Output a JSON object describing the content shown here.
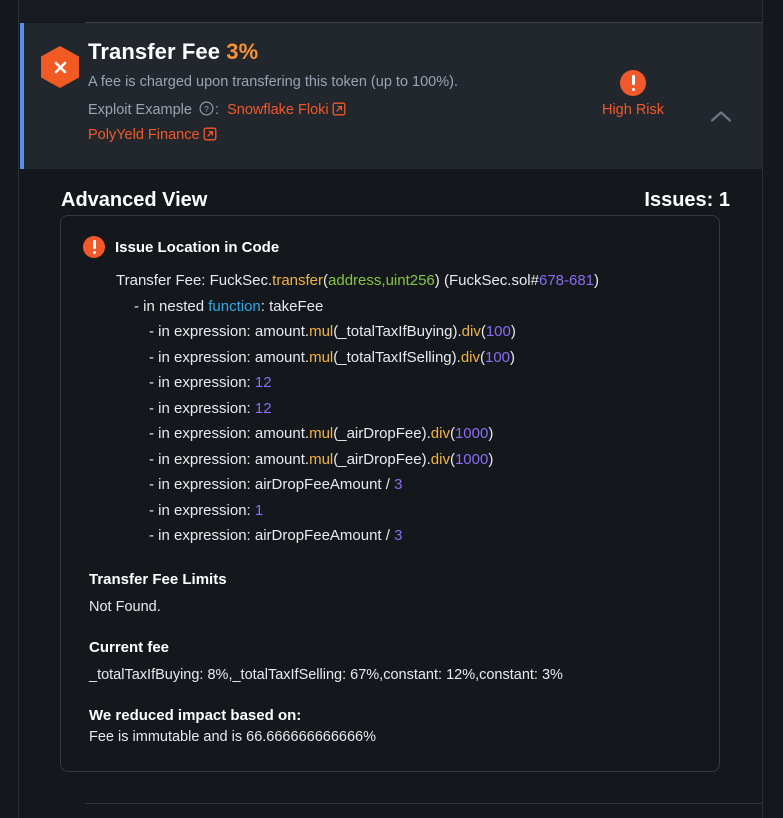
{
  "alert": {
    "icon": "hexagon-x-icon",
    "title": "Transfer Fee",
    "percent": "3%",
    "description": "A fee is charged upon transfering this token (up to 100%).",
    "exploit_label": "Exploit Example",
    "exploit_help_icon": "question-circle-icon",
    "exploit_colon": ":",
    "links": [
      {
        "label": "Snowflake Floki",
        "icon": "external-link-icon"
      },
      {
        "label": "PolyYeld Finance",
        "icon": "external-link-icon"
      }
    ],
    "risk": {
      "icon": "exclamation-circle-icon",
      "label": "High Risk",
      "color": "#f1592a"
    },
    "collapse_icon": "chevron-up-icon",
    "accent_color": "#5b8dee"
  },
  "advanced_view": {
    "title": "Advanced View",
    "issues_label": "Issues: 1"
  },
  "issue_card": {
    "header_icon": "exclamation-circle-icon",
    "header_label": "Issue Location in Code",
    "code_lines": [
      {
        "indent": 0,
        "tokens": [
          {
            "t": "Transfer Fee: FuckSec.",
            "c": "plain"
          },
          {
            "t": "transfer",
            "c": "fn"
          },
          {
            "t": "(",
            "c": "plain"
          },
          {
            "t": "address,uint256",
            "c": "type"
          },
          {
            "t": ") (FuckSec.sol#",
            "c": "plain"
          },
          {
            "t": "678-681",
            "c": "num"
          },
          {
            "t": ")",
            "c": "plain"
          }
        ]
      },
      {
        "indent": 1,
        "tokens": [
          {
            "t": "- in nested ",
            "c": "plain"
          },
          {
            "t": "function",
            "c": "kw"
          },
          {
            "t": ": takeFee",
            "c": "plain"
          }
        ]
      },
      {
        "indent": 2,
        "tokens": [
          {
            "t": "- in expression: amount.",
            "c": "plain"
          },
          {
            "t": "mul",
            "c": "fn"
          },
          {
            "t": "(_totalTaxIfBuying).",
            "c": "plain"
          },
          {
            "t": "div",
            "c": "fn"
          },
          {
            "t": "(",
            "c": "plain"
          },
          {
            "t": "100",
            "c": "num"
          },
          {
            "t": ")",
            "c": "plain"
          }
        ]
      },
      {
        "indent": 2,
        "tokens": [
          {
            "t": "- in expression: amount.",
            "c": "plain"
          },
          {
            "t": "mul",
            "c": "fn"
          },
          {
            "t": "(_totalTaxIfSelling).",
            "c": "plain"
          },
          {
            "t": "div",
            "c": "fn"
          },
          {
            "t": "(",
            "c": "plain"
          },
          {
            "t": "100",
            "c": "num"
          },
          {
            "t": ")",
            "c": "plain"
          }
        ]
      },
      {
        "indent": 2,
        "tokens": [
          {
            "t": "- in expression: ",
            "c": "plain"
          },
          {
            "t": "12",
            "c": "num"
          }
        ]
      },
      {
        "indent": 2,
        "tokens": [
          {
            "t": "- in expression: ",
            "c": "plain"
          },
          {
            "t": "12",
            "c": "num"
          }
        ]
      },
      {
        "indent": 2,
        "tokens": [
          {
            "t": "- in expression: amount.",
            "c": "plain"
          },
          {
            "t": "mul",
            "c": "fn"
          },
          {
            "t": "(_airDropFee).",
            "c": "plain"
          },
          {
            "t": "div",
            "c": "fn"
          },
          {
            "t": "(",
            "c": "plain"
          },
          {
            "t": "1000",
            "c": "num"
          },
          {
            "t": ")",
            "c": "plain"
          }
        ]
      },
      {
        "indent": 2,
        "tokens": [
          {
            "t": "- in expression: amount.",
            "c": "plain"
          },
          {
            "t": "mul",
            "c": "fn"
          },
          {
            "t": "(_airDropFee).",
            "c": "plain"
          },
          {
            "t": "div",
            "c": "fn"
          },
          {
            "t": "(",
            "c": "plain"
          },
          {
            "t": "1000",
            "c": "num"
          },
          {
            "t": ")",
            "c": "plain"
          }
        ]
      },
      {
        "indent": 2,
        "tokens": [
          {
            "t": "- in expression: airDropFeeAmount / ",
            "c": "plain"
          },
          {
            "t": "3",
            "c": "num"
          }
        ]
      },
      {
        "indent": 2,
        "tokens": [
          {
            "t": "- in expression: ",
            "c": "plain"
          },
          {
            "t": "1",
            "c": "num"
          }
        ]
      },
      {
        "indent": 2,
        "tokens": [
          {
            "t": "- in expression: airDropFeeAmount / ",
            "c": "plain"
          },
          {
            "t": "3",
            "c": "num"
          }
        ]
      }
    ],
    "sections": [
      {
        "title": "Transfer Fee Limits",
        "text": "Not Found.",
        "tight": false
      },
      {
        "title": "Current fee",
        "text": "_totalTaxIfBuying: 8%,_totalTaxIfSelling: 67%,constant: 12%,constant: 3%",
        "tight": false
      },
      {
        "title": "We reduced impact based on:",
        "text": "Fee is immutable and is 66.666666666666%",
        "tight": true
      }
    ]
  }
}
